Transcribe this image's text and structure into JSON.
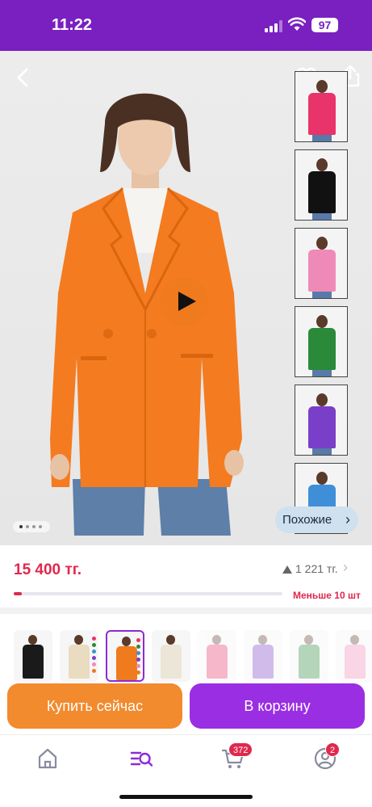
{
  "status_bar": {
    "time": "11:22",
    "battery": "97"
  },
  "product": {
    "price": "15 400 тг.",
    "reviews_count": "1 221 тг.",
    "stock_text": "Меньше 10 шт",
    "stock_fraction": 0.03,
    "similar_label": "Похожие",
    "image_index": 1,
    "image_count": 4
  },
  "color_thumbs": [
    {
      "color": "#e8336b",
      "name": "pink-blazer"
    },
    {
      "color": "#111111",
      "name": "black-blazer"
    },
    {
      "color": "#ef8ab8",
      "name": "light-pink-blazer"
    },
    {
      "color": "#2a8a3a",
      "name": "green-blazer"
    },
    {
      "color": "#7a3fc8",
      "name": "purple-blazer"
    },
    {
      "color": "#3f8fd8",
      "name": "blue-blazer"
    }
  ],
  "variants": [
    {
      "color": "#1a1a1a",
      "selected": false,
      "faded": false
    },
    {
      "color": "#e9dcc0",
      "selected": false,
      "faded": false
    },
    {
      "color": "#f07a1e",
      "selected": true,
      "faded": false
    },
    {
      "color": "#ece6d8",
      "selected": false,
      "faded": false
    },
    {
      "color": "#e8336b",
      "selected": false,
      "faded": true
    },
    {
      "color": "#7a3fc8",
      "selected": false,
      "faded": true
    },
    {
      "color": "#2a8a3a",
      "selected": false,
      "faded": true
    },
    {
      "color": "#ef8ab8",
      "selected": false,
      "faded": true
    }
  ],
  "actions": {
    "buy_now": "Купить сейчас",
    "add_to_cart": "В корзину"
  },
  "tabbar": {
    "items": [
      {
        "name": "home-icon"
      },
      {
        "name": "catalog-search-icon",
        "active": true
      },
      {
        "name": "cart-icon",
        "badge": "372"
      },
      {
        "name": "profile-icon",
        "badge": "2"
      }
    ]
  },
  "colors": {
    "brand_purple": "#7a1fc0",
    "accent_orange": "#f28a2e",
    "price_red": "#e0284d"
  }
}
